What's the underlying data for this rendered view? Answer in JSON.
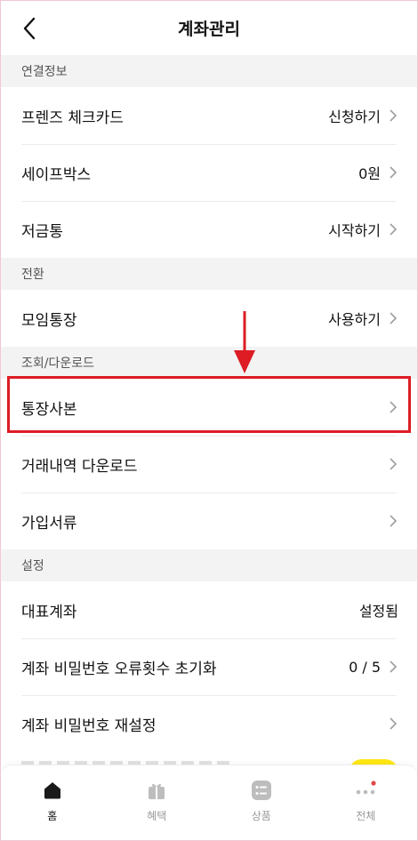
{
  "header": {
    "title": "계좌관리"
  },
  "sections": [
    {
      "title": "연결정보",
      "items": [
        {
          "label": "프렌즈 체크카드",
          "value": "신청하기",
          "chevron": true
        },
        {
          "label": "세이프박스",
          "value": "0원",
          "chevron": true
        },
        {
          "label": "저금통",
          "value": "시작하기",
          "chevron": true
        }
      ]
    },
    {
      "title": "전환",
      "items": [
        {
          "label": "모임통장",
          "value": "사용하기",
          "chevron": true
        }
      ]
    },
    {
      "title": "조회/다운로드",
      "items": [
        {
          "label": "통장사본",
          "value": "",
          "chevron": true,
          "highlighted": true
        },
        {
          "label": "거래내역 다운로드",
          "value": "",
          "chevron": true
        },
        {
          "label": "가입서류",
          "value": "",
          "chevron": true
        }
      ]
    },
    {
      "title": "설정",
      "items": [
        {
          "label": "대표계좌",
          "value": "설정됨",
          "chevron": false
        },
        {
          "label": "계좌 비밀번호 오류횟수 초기화",
          "value": "0 / 5",
          "chevron": true
        },
        {
          "label": "계좌 비밀번호 재설정",
          "value": "",
          "chevron": true
        }
      ]
    }
  ],
  "annotation": {
    "highlight_color": "#dd1c24"
  },
  "tabbar": {
    "tabs": [
      {
        "label": "홈",
        "icon": "home-icon",
        "active": true
      },
      {
        "label": "혜택",
        "icon": "gift-icon",
        "active": false
      },
      {
        "label": "상품",
        "icon": "list-icon",
        "active": false
      },
      {
        "label": "전체",
        "icon": "more-dots-icon",
        "active": false
      }
    ]
  },
  "colors": {
    "accent_yellow": "#ffe812",
    "notification_dot": "#e04848"
  }
}
